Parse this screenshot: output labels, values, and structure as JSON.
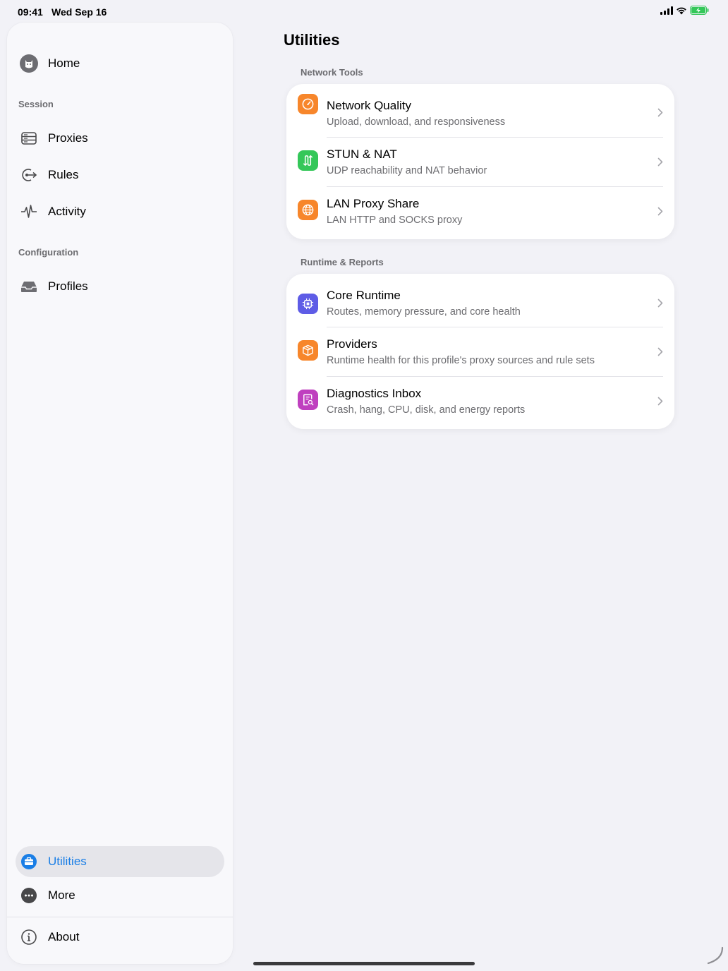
{
  "status_bar": {
    "time": "09:41",
    "date": "Wed Sep 16",
    "battery_color": "#34c759"
  },
  "sidebar": {
    "home": {
      "label": "Home",
      "icon": "app-avatar-icon"
    },
    "session_header": "Session",
    "session_items": [
      {
        "label": "Proxies",
        "icon": "server-rack-icon"
      },
      {
        "label": "Rules",
        "icon": "arrow-route-icon"
      },
      {
        "label": "Activity",
        "icon": "waveform-icon"
      }
    ],
    "configuration_header": "Configuration",
    "configuration_items": [
      {
        "label": "Profiles",
        "icon": "tray-icon"
      }
    ],
    "bottom_items": [
      {
        "label": "Utilities",
        "icon": "toolbox-icon",
        "active": true
      },
      {
        "label": "More",
        "icon": "ellipsis-circle-icon"
      }
    ],
    "about": {
      "label": "About",
      "icon": "info-circle-icon"
    },
    "accent_color": "#1a7ee6"
  },
  "main": {
    "title": "Utilities",
    "groups": [
      {
        "header": "Network Tools",
        "rows": [
          {
            "title": "Network Quality",
            "subtitle": "Upload, download, and responsiveness",
            "icon": "speedometer-icon",
            "color": "#f7862b"
          },
          {
            "title": "STUN & NAT",
            "subtitle": "UDP reachability and NAT behavior",
            "icon": "arrows-up-down-icon",
            "color": "#34c759"
          },
          {
            "title": "LAN Proxy Share",
            "subtitle": "LAN HTTP and SOCKS proxy",
            "icon": "globe-icon",
            "color": "#f7862b"
          }
        ]
      },
      {
        "header": "Runtime & Reports",
        "rows": [
          {
            "title": "Core Runtime",
            "subtitle": "Routes, memory pressure, and core health",
            "icon": "cpu-icon",
            "color": "#5e5ce6"
          },
          {
            "title": "Providers",
            "subtitle": "Runtime health for this profile's proxy sources and rule sets",
            "icon": "cube-icon",
            "color": "#f7862b"
          },
          {
            "title": "Diagnostics Inbox",
            "subtitle": "Crash, hang, CPU, disk, and energy reports",
            "icon": "report-search-icon",
            "color": "#bf40bf"
          }
        ]
      }
    ]
  }
}
